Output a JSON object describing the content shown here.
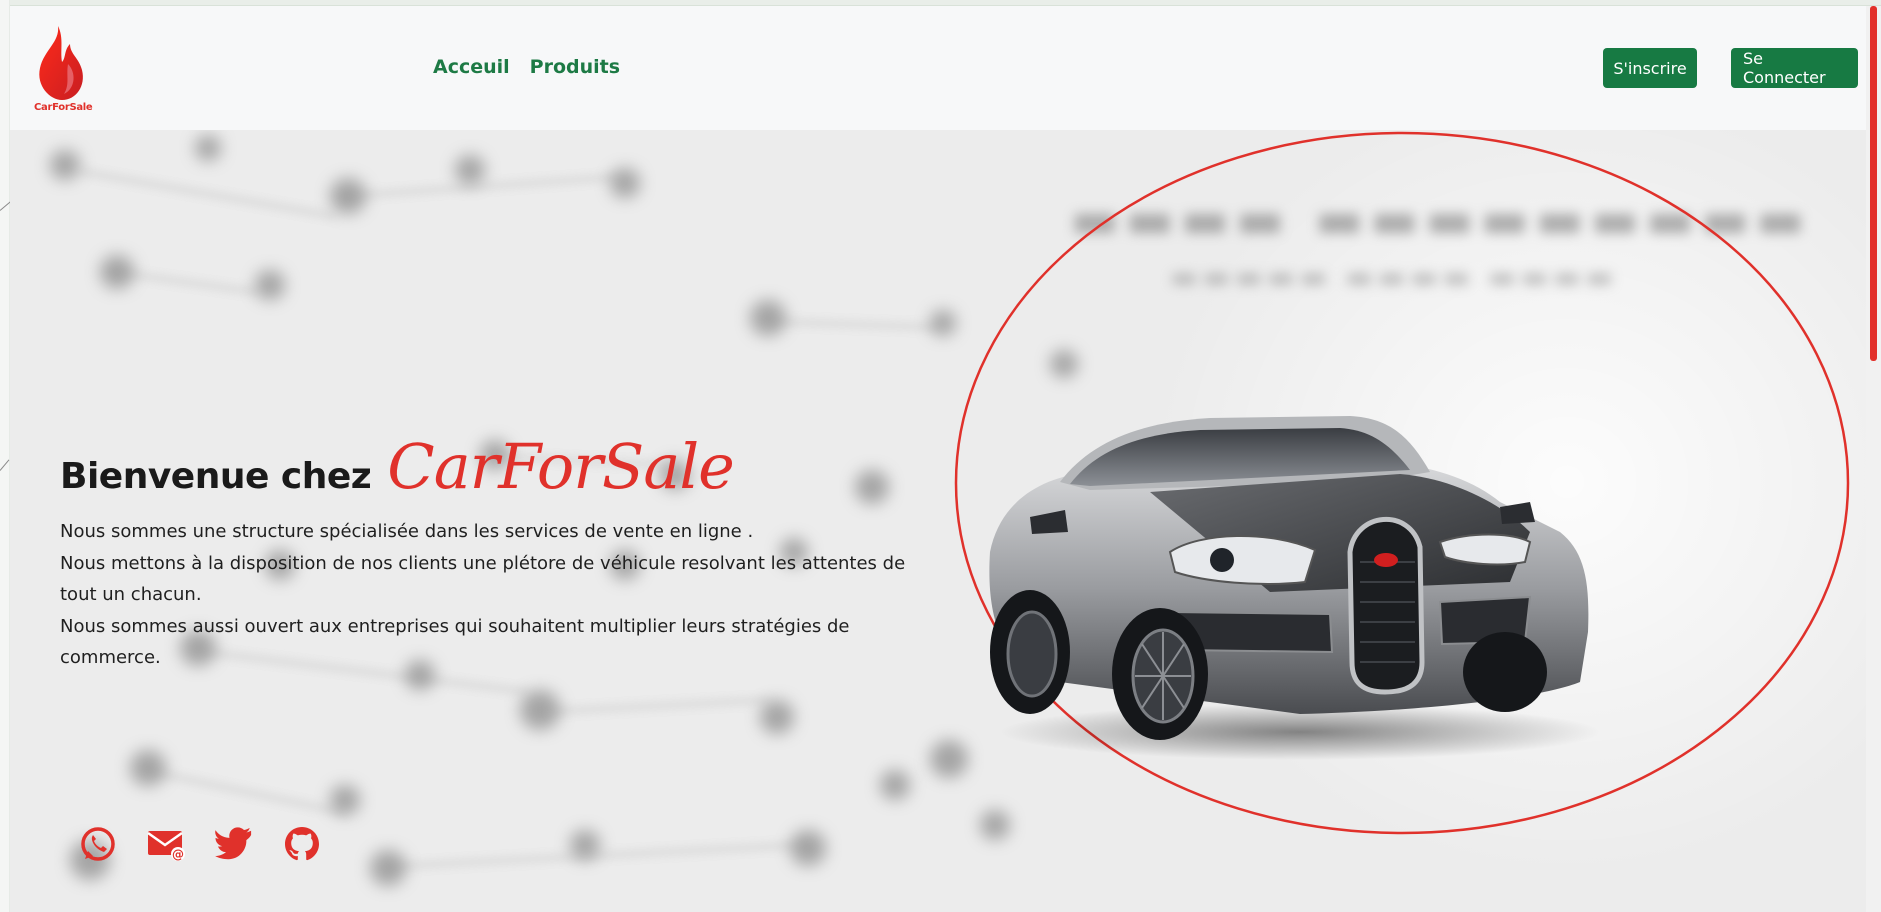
{
  "brand": {
    "logo_text": "CarForSale",
    "accent_color": "#e0312b",
    "green_color": "#177a43"
  },
  "nav": {
    "links": [
      {
        "label": "Acceuil"
      },
      {
        "label": "Produits"
      }
    ],
    "signup_label": "S'inscrire",
    "login_label": "Se Connecter"
  },
  "hero": {
    "welcome": "Bienvenue chez",
    "brand_name": "CarForSale",
    "paragraphs": [
      "Nous sommes une structure spécialisée dans les services de vente en ligne .",
      "Nous mettons à la disposition de nos clients une plétore de véhicule resolvant les attentes de tout un chacun.",
      "Nous sommes aussi ouvert aux entreprises qui souhaitent multiplier leurs stratégies de commerce."
    ],
    "socials": [
      {
        "icon": "whatsapp-icon"
      },
      {
        "icon": "email-icon"
      },
      {
        "icon": "twitter-icon"
      },
      {
        "icon": "github-icon"
      }
    ]
  }
}
